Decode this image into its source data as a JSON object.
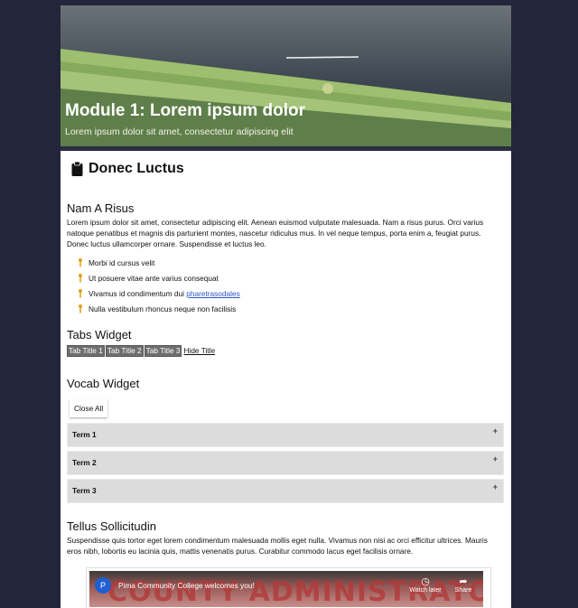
{
  "banner": {
    "title": "Module 1: Lorem ipsum dolor",
    "subtitle": "Lorem ipsum dolor sit amet, consectetur adipiscing elit"
  },
  "section": {
    "title": "Donec Luctus",
    "icon": "clipboard-icon"
  },
  "nam_a_risus": {
    "heading": "Nam A Risus",
    "paragraph": "Lorem ipsum dolor sit amet, consectetur adipiscing elit. Aenean euismod vulputate malesuada. Nam a risus purus. Orci varius natoque penatibus et magnis dis parturient montes, nascetur ridiculus mus. In vel neque tempus, porta enim a, feugiat purus. Donec luctus ullamcorper ornare. Suspendisse et luctus leo.",
    "bullets": [
      "Morbi id cursus velit",
      "Ut posuere vitae ante varius consequat",
      "Vivamus id condimentum dui ",
      "Nulla vestibulum rhoncus neque non facilisis"
    ],
    "bullet_link": "pharetrasodales",
    "bullet_icon": "pin-icon"
  },
  "tabs_widget": {
    "heading": "Tabs Widget",
    "tabs": [
      "Tab Title 1",
      "Tab Title 2",
      "Tab Title 3"
    ],
    "hide_label": "Hide Title"
  },
  "vocab_widget": {
    "heading": "Vocab Widget",
    "close_all": "Close All",
    "terms": [
      "Term 1",
      "Term 2",
      "Term 3"
    ],
    "expand_symbol": "+"
  },
  "tellus": {
    "heading": "Tellus Sollicitudin",
    "paragraph": "Suspendisse quis tortor eget lorem condimentum malesuada mollis eget nulla. Vivamus non nisi ac orci efficitur ultrices. Mauris eros nibh, lobortis eu lacinia quis, mattis venenatis purus. Curabitur commodo lacus eget facilisis ornare."
  },
  "video": {
    "channel_initial": "P",
    "title": "Pima Community College welcomes you!",
    "background_text": "COUNTY ADMINISTRATOR",
    "watch_later": "Watch later",
    "share": "Share"
  },
  "colors": {
    "background": "#23253a",
    "banner_green": "#5f7f4a",
    "tab_gray": "#6e6e6e",
    "term_gray": "#dcdcdc",
    "link_blue": "#2a55c6",
    "bullet_gold": "#e0a21a"
  }
}
